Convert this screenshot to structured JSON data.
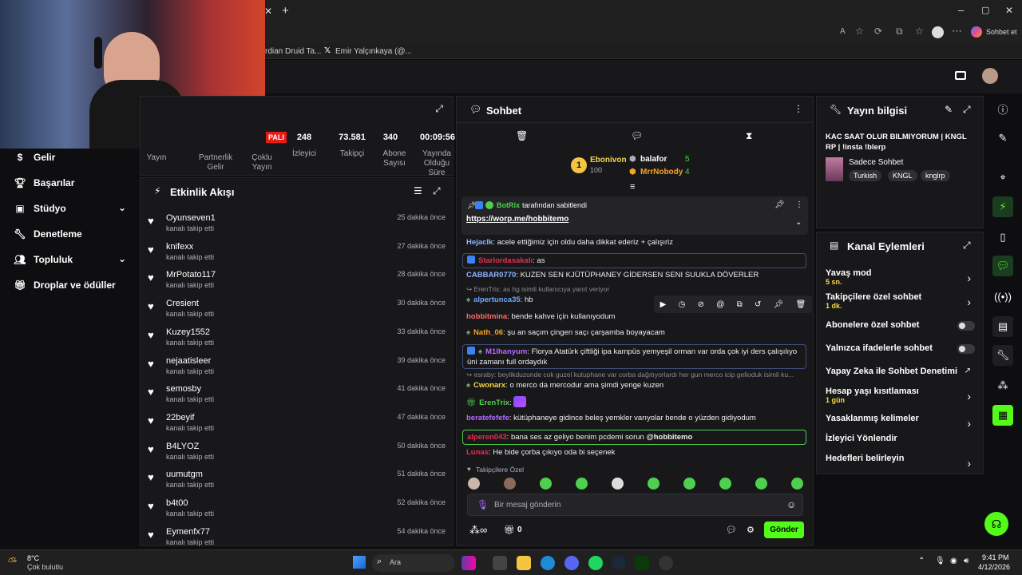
{
  "browser": {
    "tabs": [
      "rdian Druid Ta...",
      "Emir Yalçınkaya (@..."
    ],
    "copilot_label": "Sohbet et"
  },
  "stats": {
    "items": [
      {
        "value": "",
        "label": "Yayın"
      },
      {
        "value": "",
        "label": "Partnerlik Gelir"
      },
      {
        "value": "",
        "label": "Çoklu Yayın"
      },
      {
        "value": "248",
        "label": "İzleyici"
      },
      {
        "value": "73.581",
        "label": "Takipçi"
      },
      {
        "value": "340",
        "label": "Abone Sayısı"
      },
      {
        "value": "00:09:56",
        "label": "Yayında Olduğu Süre"
      }
    ],
    "live_badge": "PALI"
  },
  "sidebar": {
    "items": [
      {
        "label": "Gelir",
        "icon": "dollar-icon",
        "expand": false
      },
      {
        "label": "Başarılar",
        "icon": "trophy-icon",
        "expand": false
      },
      {
        "label": "Stüdyo",
        "icon": "studio-icon",
        "expand": true
      },
      {
        "label": "Denetleme",
        "icon": "wrench-icon",
        "expand": false
      },
      {
        "label": "Topluluk",
        "icon": "community-icon",
        "expand": true
      },
      {
        "label": "Droplar ve ödüller",
        "icon": "gift-icon",
        "expand": false
      }
    ]
  },
  "activity": {
    "title": "Etkinlik Akışı",
    "items": [
      {
        "name": "Oyunseven1",
        "action": "kanalı takip etti",
        "time": "25 dakika önce"
      },
      {
        "name": "knifexx",
        "action": "kanalı takip etti",
        "time": "27 dakika önce"
      },
      {
        "name": "MrPotato117",
        "action": "kanalı takip etti",
        "time": "28 dakika önce"
      },
      {
        "name": "Cresient",
        "action": "kanalı takip etti",
        "time": "30 dakika önce"
      },
      {
        "name": "Kuzey1552",
        "action": "kanalı takip etti",
        "time": "33 dakika önce"
      },
      {
        "name": "nejaatisleer",
        "action": "kanalı takip etti",
        "time": "39 dakika önce"
      },
      {
        "name": "semosby",
        "action": "kanalı takip etti",
        "time": "41 dakika önce"
      },
      {
        "name": "22beyif",
        "action": "kanalı takip etti",
        "time": "47 dakika önce"
      },
      {
        "name": "B4LYOZ",
        "action": "kanalı takip etti",
        "time": "50 dakika önce"
      },
      {
        "name": "uumutgm",
        "action": "kanalı takip etti",
        "time": "51 dakika önce"
      },
      {
        "name": "b4t00",
        "action": "kanalı takip etti",
        "time": "52 dakika önce"
      },
      {
        "name": "Eymenfx77",
        "action": "kanalı takip etti",
        "time": "54 dakika önce"
      }
    ]
  },
  "chat": {
    "title": "Sohbet",
    "leaderboard": [
      {
        "rank": "1",
        "name": "Ebonivon",
        "score": "100"
      },
      {
        "name": "balafor",
        "score": "5"
      },
      {
        "name": "MrrNobody",
        "score": "4"
      }
    ],
    "pinned": {
      "author": "BotRix",
      "suffix": "tarafından sabitlendi",
      "link": "https://worp.me/hobbitemo"
    },
    "messages": [
      {
        "user": "Hejaclk",
        "color": "#8fb4ff",
        "text": "acele ettiğimiz için oldu daha dikkat ederiz + çalışıriz"
      },
      {
        "user": "Starlordasakalı",
        "color": "#e0314f",
        "text": "as"
      },
      {
        "user": "CABBAR0770",
        "color": "#8fb4ff",
        "text": "KUZEN SEN KJÜTÜPHANEY GİDERSEN SENI SUUKLA DÖVERLER"
      },
      {
        "reply": "ErenTrix: as hg isimli kullanıcıya yanıt veriyor"
      },
      {
        "user": "alpertunca35",
        "color": "#6fa8ff",
        "text": "hb"
      },
      {
        "user": "hobbitmina",
        "color": "#ff6a6a",
        "text": "bende kahve için kullanıyodum"
      },
      {
        "user": "Nath_06",
        "color": "#f5a524",
        "text": "şu an saçım çingen saçı çarşamba boyayacam"
      },
      {
        "user": "M1lhanyum",
        "color": "#b36bff",
        "text": "Florya Atatürk çiftliği ipa kampüs yemyeşil orman var orda çok iyi ders çalışılıyo",
        "text2": "üni zamanı full ordaydık"
      },
      {
        "reply": "esraby: beylikduzunde cok guzel kutuphane var corba dağıtıyorlardı her gun merco icip gelioduk isimli ku..."
      },
      {
        "user": "Cwonarx",
        "color": "#f5d74b",
        "text": "o merco da mercodur ama şimdi yenge kuzen"
      },
      {
        "user": "ErenTrix",
        "color": "#4ed04e",
        "text": ""
      },
      {
        "user": "beratefefefe",
        "color": "#b36bff",
        "text": "kütüphaneye gidince beleş yemkler varıyolar bende o yüzden gidiyodum"
      },
      {
        "user": "alperen043",
        "color": "#e0314f",
        "text": "bana ses az geliyo benim pcdemi sorun",
        "mention": "@hobbitemo"
      },
      {
        "user": "Lunas",
        "color": "#e0314f",
        "text": "He bide çorba çıkıyo oda bi seçenek"
      }
    ],
    "followers_only": "Takipçilere Özel",
    "input_placeholder": "Bir mesaj gönderin",
    "points": "0",
    "send_label": "Gönder"
  },
  "stream_info": {
    "title": "Yayın bilgisi",
    "stream_title": "KAC SAAT OLUR BILMIYORUM | KNGL RP | !insta !blerp",
    "category": "Sadece Sohbet",
    "tags": [
      "Turkish",
      "KNGL",
      "knglrp"
    ]
  },
  "channel_actions": {
    "title": "Kanal Eylemleri",
    "items": [
      {
        "label": "Yavaş mod",
        "sub": "5 sn.",
        "control": "chevron"
      },
      {
        "label": "Takipçilere özel sohbet",
        "sub": "1 dk.",
        "control": "chevron"
      },
      {
        "label": "Abonelere özel sohbet",
        "sub": "",
        "control": "toggle"
      },
      {
        "label": "Yalnızca ifadelerle sohbet",
        "sub": "",
        "control": "toggle"
      },
      {
        "label": "Yapay Zeka ile Sohbet Denetimi",
        "sub": "",
        "control": "external"
      },
      {
        "label": "Hesap yaşı kısıtlaması",
        "sub": "1 gün",
        "control": "chevron"
      },
      {
        "label": "Yasaklanmış kelimeler",
        "sub": "",
        "control": "chevron"
      },
      {
        "label": "İzleyici Yönlendir",
        "sub": "",
        "control": "none"
      },
      {
        "label": "Hedefleri belirleyin",
        "sub": "",
        "control": "chevron"
      }
    ]
  },
  "taskbar": {
    "weather_temp": "8°C",
    "weather_desc": "Çok bulutlu",
    "search_label": "Ara",
    "time": "9:41 PM",
    "date": "4/12/2026"
  },
  "colors": {
    "accent": "#53fc18",
    "bg": "#0e0e10",
    "panel": "#18181b"
  }
}
